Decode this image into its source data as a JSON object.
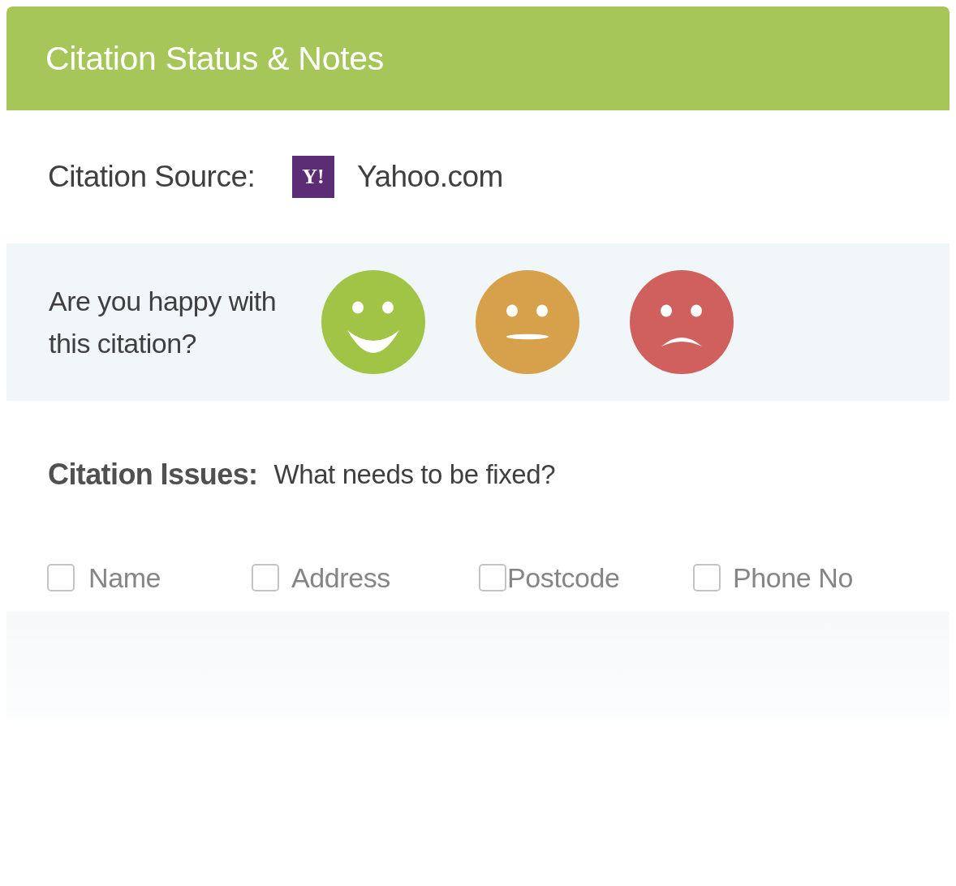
{
  "card": {
    "title": "Citation Status & Notes"
  },
  "source": {
    "label": "Citation Source:",
    "logo_text": "Y!",
    "value": "Yahoo.com"
  },
  "rating": {
    "question": "Are you happy with this citation?",
    "faces": [
      {
        "kind": "happy",
        "color": "#a1c447"
      },
      {
        "kind": "neutral",
        "color": "#d7a04b"
      },
      {
        "kind": "sad",
        "color": "#d0605d"
      }
    ]
  },
  "issues": {
    "label": "Citation Issues:",
    "prompt": "What needs to be fixed?",
    "options": [
      {
        "label": "Name",
        "checked": false
      },
      {
        "label": "Address",
        "checked": false
      },
      {
        "label": "Postcode",
        "checked": false
      },
      {
        "label": "Phone No",
        "checked": false
      }
    ]
  }
}
